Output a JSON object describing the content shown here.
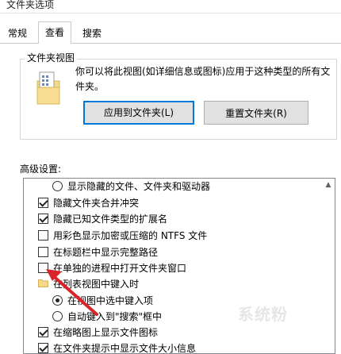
{
  "window": {
    "title": "文件夹选项"
  },
  "tabs": [
    {
      "label": "常规"
    },
    {
      "label": "查看"
    },
    {
      "label": "搜索"
    }
  ],
  "folder_views": {
    "legend": "文件夹视图",
    "description": "你可以将此视图(如详细信息或图标)应用于这种类型的所有文件夹。",
    "apply_button": "应用到文件夹(L)",
    "reset_button": "重置文件夹(R)"
  },
  "advanced": {
    "label": "高级设置:",
    "items": [
      {
        "type": "radio",
        "selected": false,
        "label": "显示隐藏的文件、文件夹和驱动器"
      },
      {
        "type": "checkbox",
        "checked": true,
        "label": "隐藏文件夹合并冲突"
      },
      {
        "type": "checkbox",
        "checked": true,
        "label": "隐藏已知文件类型的扩展名"
      },
      {
        "type": "checkbox",
        "checked": false,
        "label": "用彩色显示加密或压缩的 NTFS 文件"
      },
      {
        "type": "checkbox",
        "checked": false,
        "label": "在标题栏中显示完整路径"
      },
      {
        "type": "checkbox",
        "checked": false,
        "label": "在单独的进程中打开文件夹窗口"
      },
      {
        "type": "folder",
        "label": "在列表视图中键入时"
      },
      {
        "type": "radio",
        "selected": true,
        "label": "在视图中选中键入项"
      },
      {
        "type": "radio",
        "selected": false,
        "label": "自动键入到\"搜索\"框中"
      },
      {
        "type": "checkbox",
        "checked": true,
        "label": "在缩略图上显示文件图标"
      },
      {
        "type": "checkbox",
        "checked": true,
        "label": "在文件夹提示中显示文件大小信息"
      }
    ]
  },
  "colors": {
    "accent": "#0078d7",
    "annotation": "#d9252a"
  },
  "watermark": "系统粉"
}
